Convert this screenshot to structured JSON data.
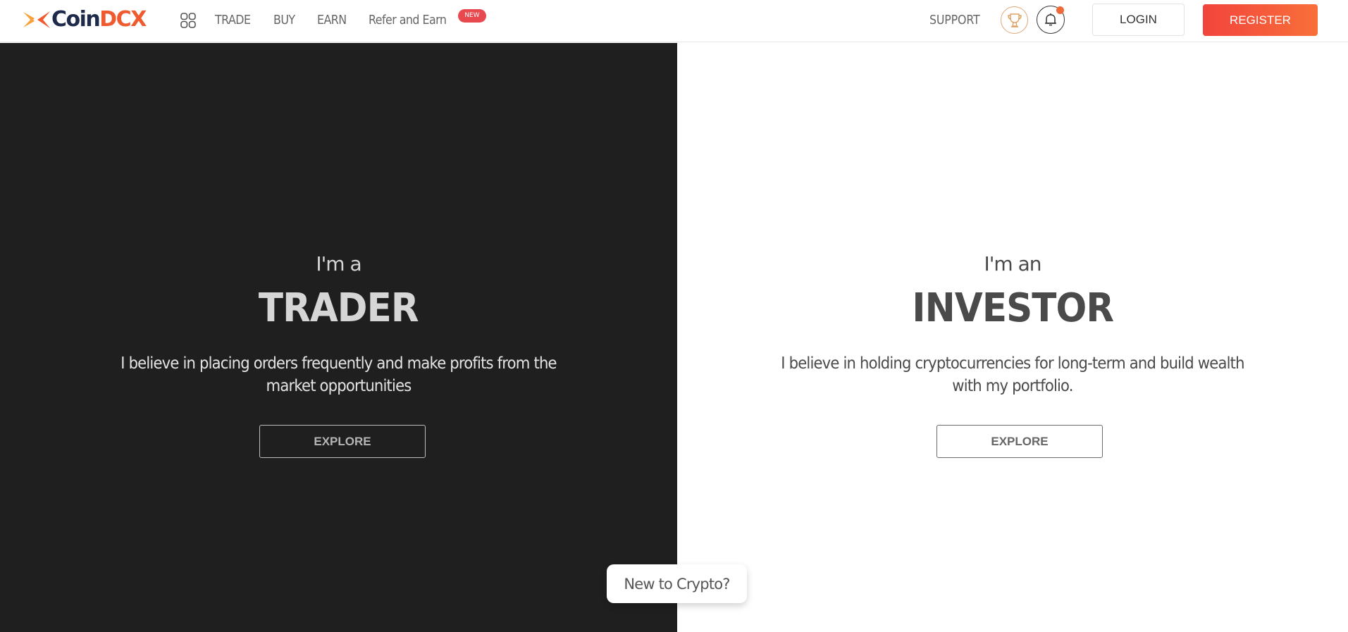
{
  "header": {
    "logo": {
      "text_primary": "Coin",
      "text_accent": "DCX",
      "accent_color": "#ef5a2e",
      "primary_color": "#1e2a4a"
    },
    "apps_icon": "grid-icon",
    "nav": [
      {
        "label": "TRADE"
      },
      {
        "label": "BUY"
      },
      {
        "label": "EARN"
      },
      {
        "label": "Refer and Earn",
        "badge": "NEW"
      }
    ],
    "support_label": "SUPPORT",
    "trophy_icon": "trophy-icon",
    "bell_icon": "bell-icon",
    "login_label": "LOGIN",
    "register_label": "REGISTER"
  },
  "panels": {
    "trader": {
      "intro": "I'm a",
      "role": "TRADER",
      "description": "I believe in placing orders frequently and make profits from the market opportunities",
      "button_label": "EXPLORE",
      "background": "#1f1f1f"
    },
    "investor": {
      "intro": "I'm an",
      "role": "INVESTOR",
      "description": "I believe in holding cryptocurrencies for long-term and build wealth with my portfolio.",
      "button_label": "EXPLORE",
      "background": "#ffffff"
    }
  },
  "floating": {
    "new_to_crypto_label": "New to Crypto?"
  },
  "colors": {
    "register_gradient_start": "#f2443c",
    "register_gradient_end": "#f86f3a",
    "notification_dot": "#ef6a3a",
    "new_badge": "#e8494f"
  }
}
